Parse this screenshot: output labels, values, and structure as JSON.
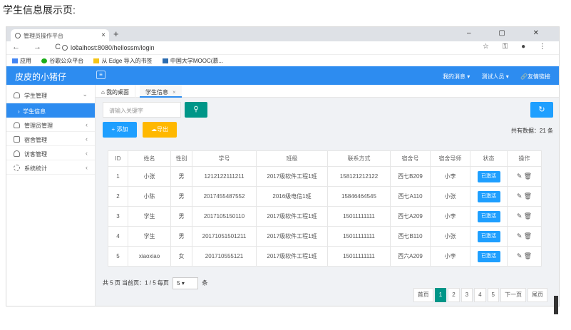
{
  "caption": "学生信息展示页:",
  "browser": {
    "tab_title": "管理员操作平台",
    "tab_close": "×",
    "new_tab": "+",
    "window_controls": "– ▢ ✕",
    "nav_buttons": "← → C ⌂",
    "url": "localhost:8080/hellossm/login",
    "addr_right": "☆ ⚿ ● ⋮",
    "bookmarks": [
      "应用",
      "谷歌公众平台",
      "从 Edge 导入的书签",
      "中国大学MOOC(慕..."
    ]
  },
  "app": {
    "brand": "皮皮的小猪仔",
    "menu_icon": "≡",
    "top_menu": [
      "我的消息 ▾",
      "测试人员 ▾",
      "🔗友情链接"
    ]
  },
  "sidebar": {
    "student_mgmt": "学生管理",
    "student_info": "学生信息",
    "admin_mgmt": "管理员管理",
    "dorm_mgmt": "宿舍管理",
    "visitor_mgmt": "访客管理",
    "stats": "系统统计",
    "arrow_down": "⌄",
    "arrow_left": "‹",
    "sub_arrow": "›"
  },
  "tabs": {
    "home": "我的桌面",
    "current": "学生信息",
    "close": "×"
  },
  "toolbar": {
    "search_placeholder": "请输入关键字",
    "search_icon": "⚲",
    "refresh_icon": "↻",
    "add_label": "+ 添加",
    "export_label": "☁导出",
    "total_text": "共有数据：21 条"
  },
  "table": {
    "headers": [
      "ID",
      "姓名",
      "性别",
      "学号",
      "班级",
      "联系方式",
      "宿舍号",
      "宿舍导师",
      "状态",
      "操作"
    ],
    "rows": [
      [
        "1",
        "小张",
        "男",
        "1212122111211",
        "2017级软件工程1班",
        "158121212122",
        "西七B209",
        "小李",
        "已激活"
      ],
      [
        "2",
        "小陈",
        "男",
        "2017455487552",
        "2016级电信1班",
        "15846464545",
        "西七A110",
        "小张",
        "已激活"
      ],
      [
        "3",
        "学生",
        "男",
        "2017105150110",
        "2017级软件工程1班",
        "15011111111",
        "西七A209",
        "小李",
        "已激活"
      ],
      [
        "4",
        "学生",
        "男",
        "20171051501211",
        "2017级软件工程1班",
        "15011111111",
        "西七B110",
        "小张",
        "已激活"
      ],
      [
        "5",
        "xiaoxiao",
        "女",
        "201710555121",
        "2017级软件工程1班",
        "15011111111",
        "西六A209",
        "小李",
        "已激活"
      ]
    ],
    "edit_icon": "✎",
    "delete_icon": "🗑"
  },
  "pager": {
    "summary_a": "共 5 页  当前页：1 / 5  每页",
    "page_size": "5",
    "summary_b": "条",
    "first": "首页",
    "pages": [
      "1",
      "2",
      "3",
      "4",
      "5"
    ],
    "next": "下一页",
    "last": "尾页"
  }
}
